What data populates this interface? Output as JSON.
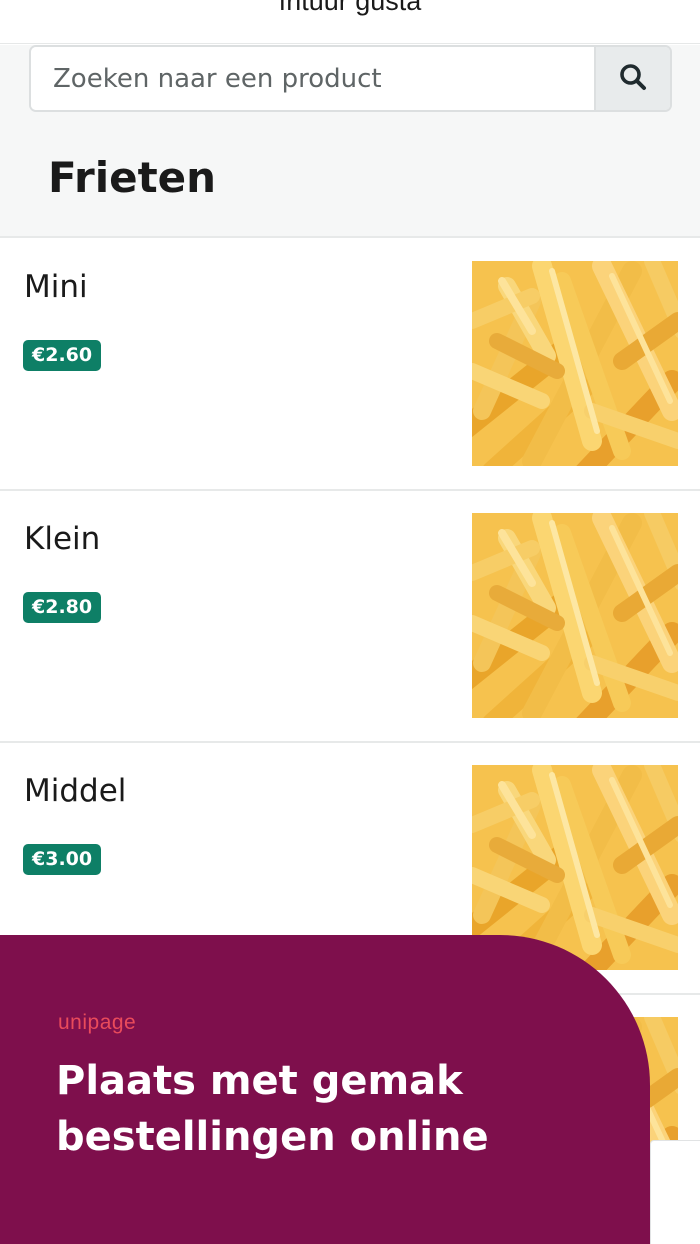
{
  "header": {
    "title": "frituur gusta"
  },
  "search": {
    "placeholder": "Zoeken naar een product",
    "icon": "search-icon"
  },
  "section": {
    "title": "Frieten"
  },
  "products": [
    {
      "name": "Mini",
      "price": "€2.60",
      "image": "fries-photo"
    },
    {
      "name": "Klein",
      "price": "€2.80",
      "image": "fries-photo"
    },
    {
      "name": "Middel",
      "price": "€3.00",
      "image": "fries-photo"
    },
    {
      "name": "",
      "price": "",
      "image": "fries-photo"
    }
  ],
  "promo": {
    "brand": "unipage",
    "headline": "Plaats met gemak bestellingen online"
  },
  "colors": {
    "price_badge": "#0e7f66",
    "promo_background": "#7e0f4c",
    "brand_accent": "#e94b5b"
  }
}
